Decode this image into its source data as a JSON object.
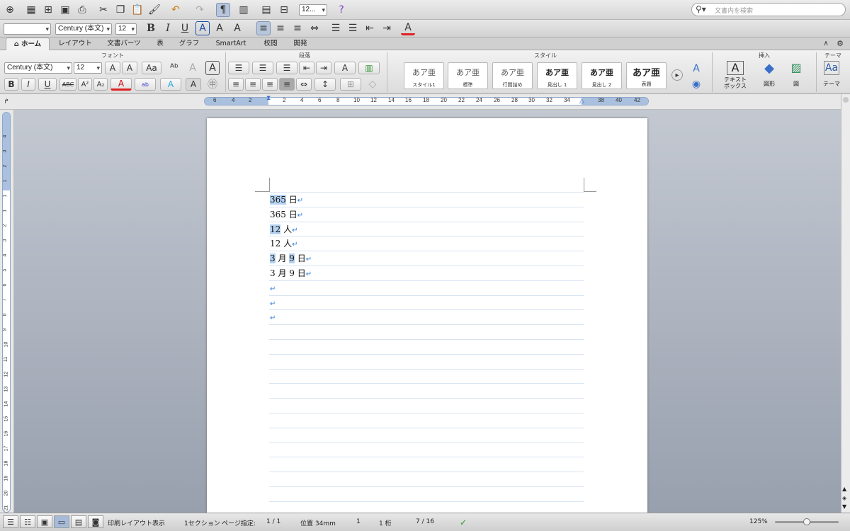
{
  "toolbar": {
    "font_size_box": "12...",
    "search_placeholder": "文書内を検索"
  },
  "format_bar": {
    "style_box": "",
    "font_name": "Century (本文)",
    "font_size": "12"
  },
  "tabs": [
    {
      "label": "ホーム",
      "active": true
    },
    {
      "label": "レイアウト"
    },
    {
      "label": "文書パーツ"
    },
    {
      "label": "表"
    },
    {
      "label": "グラフ"
    },
    {
      "label": "SmartArt"
    },
    {
      "label": "校閲"
    },
    {
      "label": "開発"
    }
  ],
  "ribbon": {
    "font_group": "フォント",
    "paragraph_group": "段落",
    "style_group": "スタイル",
    "insert_group": "挿入",
    "theme_group": "テーマ",
    "font_name": "Century (本文)",
    "font_size": "12",
    "styles": [
      {
        "sample": "あア亜",
        "name": "スタイル1"
      },
      {
        "sample": "あア亜",
        "name": "標準"
      },
      {
        "sample": "あア亜",
        "name": "行間詰め"
      },
      {
        "sample": "あア亜",
        "name": "見出し 1"
      },
      {
        "sample": "あア亜",
        "name": "見出し 2"
      },
      {
        "sample": "あア亜",
        "name": "表題"
      }
    ],
    "textbox_label": "テキスト\nボックス",
    "shape_label": "図形",
    "picture_label": "図",
    "theme_label": "テーマ"
  },
  "ruler_numbers": [
    "6",
    "4",
    "2",
    "2",
    "4",
    "6",
    "8",
    "10",
    "12",
    "14",
    "16",
    "18",
    "20",
    "22",
    "24",
    "26",
    "28",
    "30",
    "32",
    "34",
    "38",
    "40",
    "42"
  ],
  "vruler_numbers": [
    "4",
    "3",
    "2",
    "1",
    "1",
    "1",
    "2",
    "3",
    "4",
    "5",
    "6",
    "7",
    "8",
    "9",
    "10",
    "11",
    "12",
    "13",
    "14",
    "15",
    "16",
    "17",
    "18",
    "19",
    "20",
    "21"
  ],
  "document": {
    "lines": [
      {
        "parts": [
          {
            "t": "365",
            "hl": true
          },
          {
            "t": " 日"
          }
        ]
      },
      {
        "parts": [
          {
            "t": "365 日"
          }
        ]
      },
      {
        "parts": [
          {
            "t": "12",
            "hl": true
          },
          {
            "t": " 人"
          }
        ]
      },
      {
        "parts": [
          {
            "t": "12 人"
          }
        ]
      },
      {
        "parts": [
          {
            "t": "3",
            "hl": true
          },
          {
            "t": " 月 "
          },
          {
            "t": "9",
            "hl": true
          },
          {
            "t": " 日"
          }
        ]
      },
      {
        "parts": [
          {
            "t": "3 月 9 日"
          }
        ]
      },
      {
        "parts": []
      },
      {
        "parts": []
      },
      {
        "parts": []
      }
    ],
    "para_mark": "↵"
  },
  "status": {
    "view_name": "印刷レイアウト表示",
    "section": "1セクション",
    "page_label": "ページ指定:",
    "page": "1 / 1",
    "position": "位置 34mm",
    "row": "1",
    "col": "1 桁",
    "words": "7 / 16",
    "zoom": "125%"
  },
  "colors": {
    "highlight": "#b5d3f2",
    "para_mark": "#2a7bd8",
    "font_color_underline": "#e02020"
  }
}
